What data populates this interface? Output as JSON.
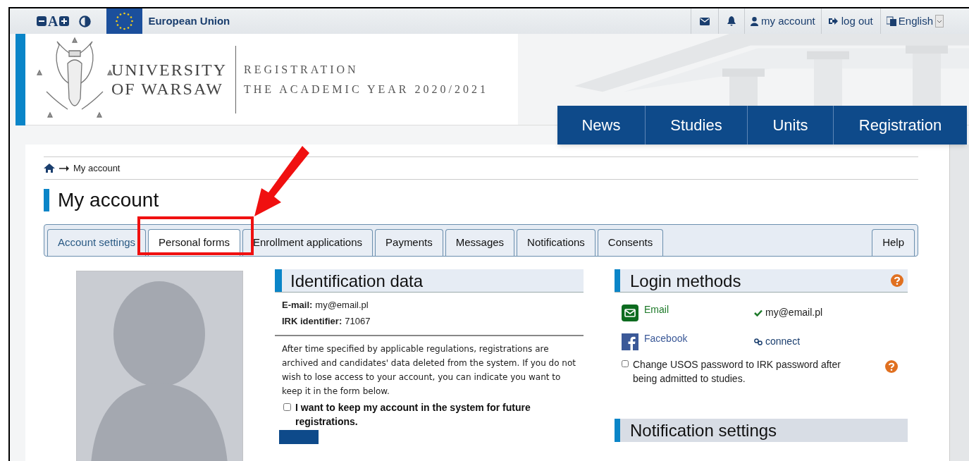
{
  "top_bar": {
    "font_controls": [
      "A"
    ],
    "eu_label": "European Union",
    "account_link": "my account",
    "logout_link": "log out",
    "language": "English"
  },
  "header": {
    "university": [
      "UNIVERSITY",
      "OF WARSAW"
    ],
    "subtitle": [
      "REGISTRATION",
      "THE ACADEMIC YEAR 2020/2021"
    ]
  },
  "nav": [
    {
      "label": "News"
    },
    {
      "label": "Studies"
    },
    {
      "label": "Units"
    },
    {
      "label": "Registration"
    }
  ],
  "breadcrumb": "My account",
  "page_title": "My account",
  "tabs": [
    {
      "label": "Account settings",
      "selected": true,
      "hovered": false
    },
    {
      "label": "Personal forms",
      "selected": false,
      "hovered": true
    },
    {
      "label": "Enrollment applications",
      "selected": false,
      "hovered": false
    },
    {
      "label": "Payments",
      "selected": false,
      "hovered": false
    },
    {
      "label": "Messages",
      "selected": false,
      "hovered": false
    },
    {
      "label": "Notifications",
      "selected": false,
      "hovered": false
    },
    {
      "label": "Consents",
      "selected": false,
      "hovered": false
    }
  ],
  "help_tab": "Help",
  "identification": {
    "title": "Identification data",
    "fields": [
      {
        "label": "E-mail:",
        "value": "my@email.pl"
      },
      {
        "label": "IRK identifier:",
        "value": "71067"
      }
    ],
    "notice": "After time specified by applicable regulations, registrations are archived and candidates' data deleted from the system. If you do not wish to lose access to your account, you can indicate you want to keep it in the form below.",
    "keep_account": {
      "label": "I want to keep my account in the system for future registrations.",
      "checked": false
    }
  },
  "login_methods": {
    "title": "Login methods",
    "methods": [
      {
        "kind": "email",
        "name": "Email",
        "status": "my@email.pl",
        "connected": true
      },
      {
        "kind": "facebook",
        "name": "Facebook",
        "status": "connect",
        "connected": false
      }
    ],
    "change_password": {
      "label": "Change USOS password to IRK password after being admitted to studies.",
      "checked": false
    }
  },
  "notification_settings": {
    "title": "Notification settings"
  }
}
